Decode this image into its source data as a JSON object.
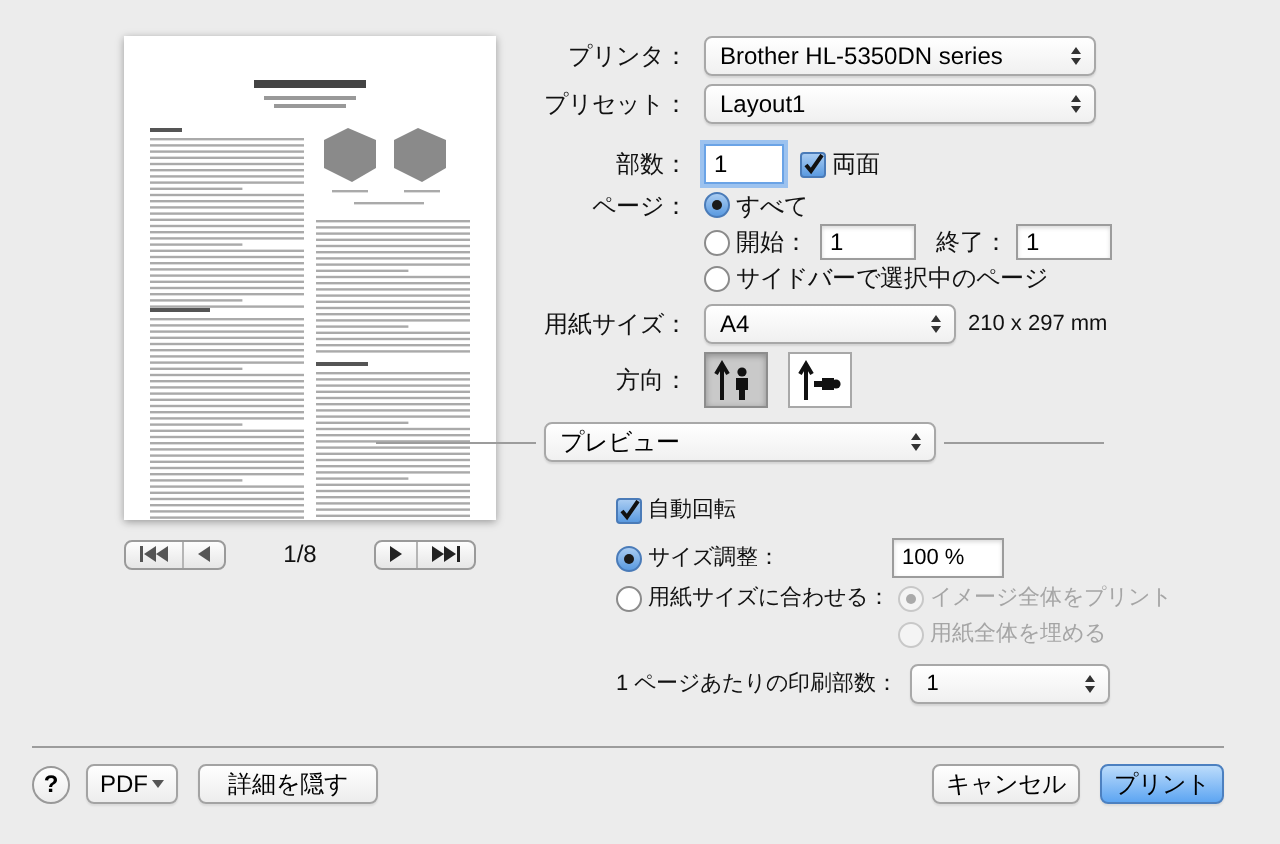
{
  "preview": {
    "page_indicator": "1/8"
  },
  "printer": {
    "label": "プリンタ：",
    "value": "Brother HL-5350DN series"
  },
  "preset": {
    "label": "プリセット：",
    "value": "Layout1"
  },
  "copies": {
    "label": "部数：",
    "value": "1",
    "duplex": {
      "label": "両面",
      "checked": true
    }
  },
  "pages": {
    "label": "ページ：",
    "options": [
      {
        "kind": "all",
        "label": "すべて",
        "selected": true
      },
      {
        "kind": "range",
        "label": "開始：",
        "selected": false,
        "from": "1",
        "to_label": "終了：",
        "to": "1"
      },
      {
        "kind": "sidebar",
        "label": "サイドバーで選択中のページ",
        "selected": false
      }
    ]
  },
  "paper_size": {
    "label": "用紙サイズ：",
    "value": "A4",
    "dimensions": "210 x 297 mm"
  },
  "orientation": {
    "label": "方向：",
    "options": [
      {
        "kind": "portrait",
        "selected": true
      },
      {
        "kind": "landscape",
        "selected": false
      }
    ]
  },
  "section_popup": {
    "value": "プレビュー"
  },
  "auto_rotate": {
    "label": "自動回転",
    "checked": true
  },
  "scaling": {
    "options": [
      {
        "kind": "scale",
        "label": "サイズ調整：",
        "selected": true,
        "value": "100 %"
      },
      {
        "kind": "fit",
        "label": "用紙サイズに合わせる：",
        "selected": false,
        "sub_options": [
          {
            "label": "イメージ全体をプリント",
            "selected": true,
            "disabled": true
          },
          {
            "label": "用紙全体を埋める",
            "selected": false,
            "disabled": true
          }
        ]
      }
    ]
  },
  "pages_per_sheet": {
    "label": "1 ページあたりの印刷部数：",
    "value": "1"
  },
  "footer": {
    "help": "?",
    "pdf": "PDF",
    "hide_details": "詳細を隠す",
    "cancel": "キャンセル",
    "print": "プリント"
  }
}
